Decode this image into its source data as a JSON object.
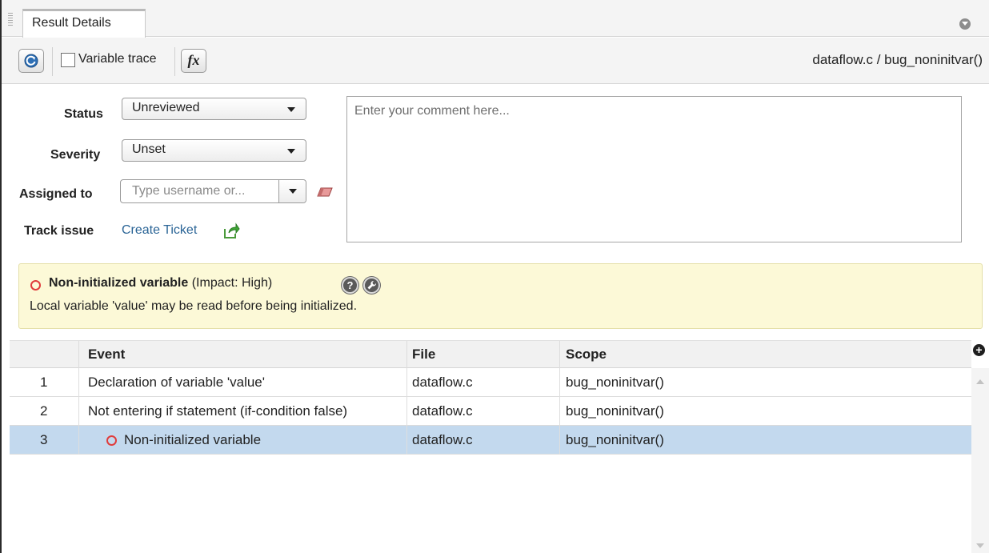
{
  "tab": {
    "title": "Result Details"
  },
  "toolbar": {
    "variable_trace_label": "Variable trace",
    "fx_label": "fx",
    "breadcrumb": "dataflow.c / bug_noninitvar()"
  },
  "form": {
    "status_label": "Status",
    "status_value": "Unreviewed",
    "severity_label": "Severity",
    "severity_value": "Unset",
    "assigned_label": "Assigned to",
    "assigned_placeholder": "Type username or...",
    "track_label": "Track issue",
    "create_ticket": "Create Ticket",
    "comment_placeholder": "Enter your comment here..."
  },
  "alert": {
    "title": "Non-initialized variable",
    "impact": "(Impact: High)",
    "description": "Local variable 'value' may be read before being initialized.",
    "help_glyph": "?"
  },
  "table": {
    "headers": {
      "event": "Event",
      "file": "File",
      "scope": "Scope"
    },
    "rows": [
      {
        "num": "1",
        "event": "Declaration of variable 'value'",
        "file": "dataflow.c",
        "scope": "bug_noninitvar()"
      },
      {
        "num": "2",
        "event": "Not entering if statement (if-condition false)",
        "file": "dataflow.c",
        "scope": "bug_noninitvar()"
      },
      {
        "num": "3",
        "event": "Non-initialized variable",
        "file": "dataflow.c",
        "scope": "bug_noninitvar()"
      }
    ],
    "add_column_glyph": "+"
  },
  "colors": {
    "selected_row": "#c3d9ee",
    "alert_bg": "#fcf9d7",
    "defect_red": "#e03c3c",
    "link": "#2a6496"
  }
}
